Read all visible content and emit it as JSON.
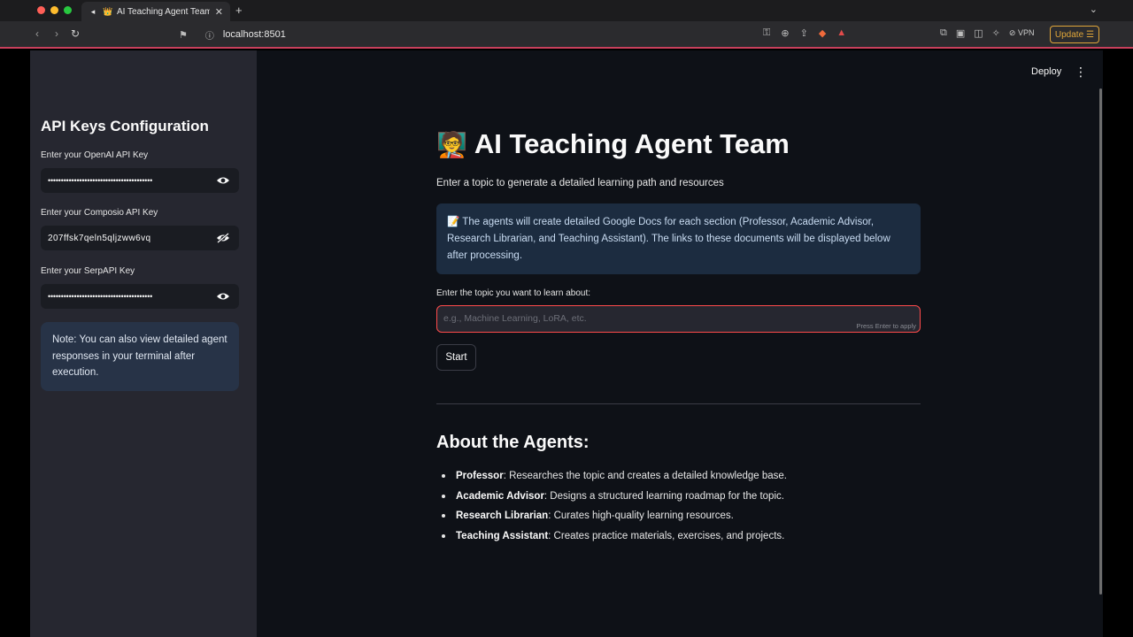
{
  "browser": {
    "tab_title": "AI Teaching Agent Team",
    "new_tab": "+",
    "url": "localhost:8501",
    "vpn_label": "VPN",
    "update_label": "Update"
  },
  "sidebar": {
    "title": "API Keys Configuration",
    "fields": [
      {
        "label": "Enter your OpenAI API Key",
        "value": "••••••••••••••••••••••••••••••••••••••••",
        "visible": false
      },
      {
        "label": "Enter your Composio API Key",
        "value": "207ffsk7qeln5qljzww6vq",
        "visible": true
      },
      {
        "label": "Enter your SerpAPI Key",
        "value": "••••••••••••••••••••••••••••••••••••••••",
        "visible": false
      }
    ],
    "note": "Note: You can also view detailed agent responses in your terminal after execution."
  },
  "header": {
    "deploy_label": "Deploy",
    "menu_icon": "⋮"
  },
  "main": {
    "title_emoji": "🧑‍🏫",
    "title": "AI Teaching Agent Team",
    "subtitle": "Enter a topic to generate a detailed learning path and resources",
    "info": "📝 The agents will create detailed Google Docs for each section (Professor, Academic Advisor, Research Librarian, and Teaching Assistant). The links to these documents will be displayed below after processing.",
    "topic_label": "Enter the topic you want to learn about:",
    "topic_placeholder": "e.g., Machine Learning, LoRA, etc.",
    "topic_hint": "Press Enter to apply",
    "start_label": "Start",
    "about_title": "About the Agents:",
    "agents": [
      {
        "name": "Professor",
        "desc": ": Researches the topic and creates a detailed knowledge base."
      },
      {
        "name": "Academic Advisor",
        "desc": ": Designs a structured learning roadmap for the topic."
      },
      {
        "name": "Research Librarian",
        "desc": ": Curates high-quality learning resources."
      },
      {
        "name": "Teaching Assistant",
        "desc": ": Creates practice materials, exercises, and projects."
      }
    ]
  }
}
